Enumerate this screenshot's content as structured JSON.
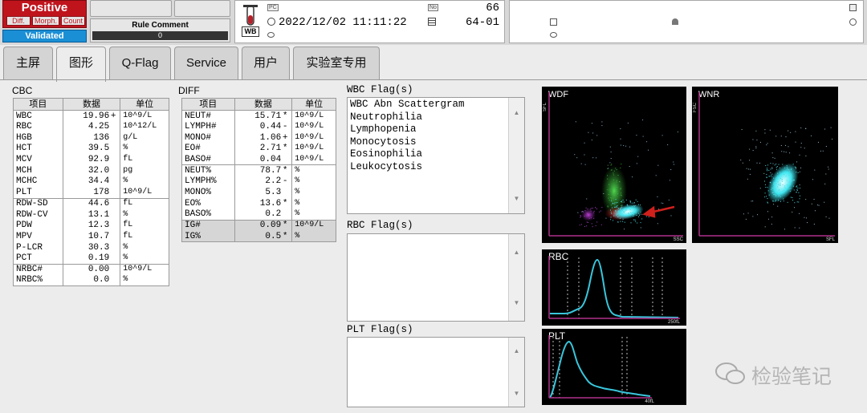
{
  "status": {
    "result": "Positive",
    "chips": [
      "Diff.",
      "Morph.",
      "Count"
    ],
    "validated": "Validated"
  },
  "rule_comment": {
    "label": "Rule Comment",
    "value": "0"
  },
  "sample": {
    "icon_labels": [
      "PC",
      "No"
    ],
    "tube_label": "WB",
    "datetime": "2022/12/02 11:11:22",
    "number": "66",
    "rack": "64-01"
  },
  "tabs": [
    "主屏",
    "图形",
    "Q-Flag",
    "Service",
    "用户",
    "实验室专用"
  ],
  "active_tab": "图形",
  "cbc": {
    "title": "CBC",
    "headers": [
      "项目",
      "数据",
      "单位"
    ],
    "rows": [
      {
        "item": "WBC",
        "value": "19.96",
        "flag": "+",
        "unit": "10^9/L"
      },
      {
        "item": "RBC",
        "value": "4.25",
        "flag": "",
        "unit": "10^12/L"
      },
      {
        "item": "HGB",
        "value": "136",
        "flag": "",
        "unit": "g/L"
      },
      {
        "item": "HCT",
        "value": "39.5",
        "flag": "",
        "unit": "%"
      },
      {
        "item": "MCV",
        "value": "92.9",
        "flag": "",
        "unit": "fL"
      },
      {
        "item": "MCH",
        "value": "32.0",
        "flag": "",
        "unit": "pg"
      },
      {
        "item": "MCHC",
        "value": "34.4",
        "flag": "",
        "unit": "%"
      },
      {
        "item": "PLT",
        "value": "178",
        "flag": "",
        "unit": "10^9/L"
      },
      {
        "item": "RDW-SD",
        "value": "44.6",
        "flag": "",
        "unit": "fL"
      },
      {
        "item": "RDW-CV",
        "value": "13.1",
        "flag": "",
        "unit": "%"
      },
      {
        "item": "PDW",
        "value": "12.3",
        "flag": "",
        "unit": "fL"
      },
      {
        "item": "MPV",
        "value": "10.7",
        "flag": "",
        "unit": "fL"
      },
      {
        "item": "P-LCR",
        "value": "30.3",
        "flag": "",
        "unit": "%"
      },
      {
        "item": "PCT",
        "value": "0.19",
        "flag": "",
        "unit": "%"
      },
      {
        "item": "NRBC#",
        "value": "0.00",
        "flag": "",
        "unit": "10^9/L"
      },
      {
        "item": "NRBC%",
        "value": "0.0",
        "flag": "",
        "unit": "%"
      }
    ]
  },
  "diff": {
    "title": "DIFF",
    "headers": [
      "项目",
      "数据",
      "单位"
    ],
    "rows": [
      {
        "item": "NEUT#",
        "value": "15.71",
        "flag": "*",
        "unit": "10^9/L"
      },
      {
        "item": "LYMPH#",
        "value": "0.44",
        "flag": "-",
        "unit": "10^9/L"
      },
      {
        "item": "MONO#",
        "value": "1.06",
        "flag": "+",
        "unit": "10^9/L"
      },
      {
        "item": "EO#",
        "value": "2.71",
        "flag": "*",
        "unit": "10^9/L"
      },
      {
        "item": "BASO#",
        "value": "0.04",
        "flag": "",
        "unit": "10^9/L"
      },
      {
        "item": "NEUT%",
        "value": "78.7",
        "flag": "*",
        "unit": "%"
      },
      {
        "item": "LYMPH%",
        "value": "2.2",
        "flag": "-",
        "unit": "%"
      },
      {
        "item": "MONO%",
        "value": "5.3",
        "flag": "",
        "unit": "%"
      },
      {
        "item": "EO%",
        "value": "13.6",
        "flag": "*",
        "unit": "%"
      },
      {
        "item": "BASO%",
        "value": "0.2",
        "flag": "",
        "unit": "%"
      },
      {
        "item": "IG#",
        "value": "0.09",
        "flag": "*",
        "unit": "10^9/L"
      },
      {
        "item": "IG%",
        "value": "0.5",
        "flag": "*",
        "unit": "%"
      }
    ]
  },
  "wbc_flags": {
    "title": "WBC Flag(s)",
    "items": [
      "WBC Abn Scattergram",
      "Neutrophilia",
      "Lymphopenia",
      "Monocytosis",
      "Eosinophilia",
      "Leukocytosis"
    ]
  },
  "rbc_flags": {
    "title": "RBC Flag(s)",
    "items": []
  },
  "plt_flags": {
    "title": "PLT Flag(s)",
    "items": []
  },
  "plots": {
    "wdf": {
      "title": "WDF",
      "x_axis": "SSC",
      "y_axis": "SFL"
    },
    "wnr": {
      "title": "WNR",
      "x_axis": "SFL",
      "y_axis": "FSC"
    },
    "rbc": {
      "title": "RBC",
      "x_end": "250fL"
    },
    "plt": {
      "title": "PLT",
      "x_end": "40fL"
    }
  },
  "watermark": "检验笔记",
  "colors": {
    "positive": "#c0141d",
    "validated": "#1a8fd6",
    "plot_axis": "#b0308a",
    "histogram_line": "#39c6dc",
    "arrow": "#d0201c"
  }
}
